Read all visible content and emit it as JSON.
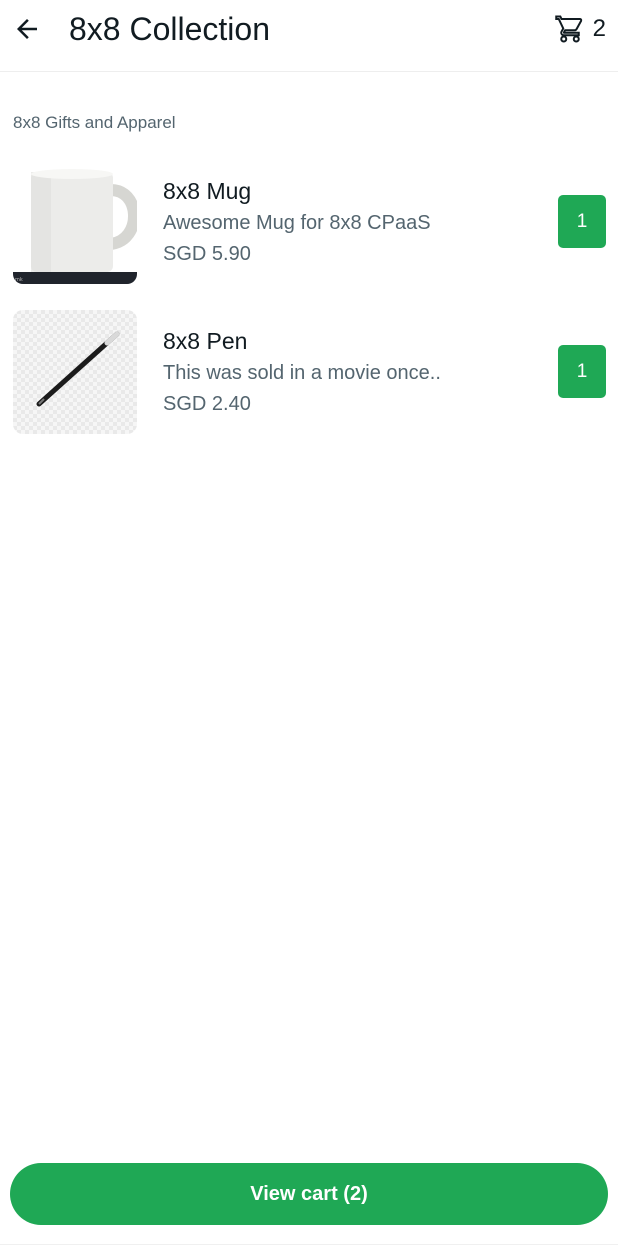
{
  "header": {
    "title": "8x8 Collection",
    "back_icon": "arrow-left-icon",
    "cart_icon": "cart-icon",
    "cart_count": "2"
  },
  "section": {
    "label": "8x8 Gifts and Apparel"
  },
  "products": [
    {
      "name": "8x8 Mug",
      "description": "Awesome Mug for 8x8 CPaaS",
      "price": "SGD 5.90",
      "quantity": "1",
      "image": "mug-image"
    },
    {
      "name": "8x8 Pen",
      "description": "This was sold in a movie once..",
      "price": "SGD 2.40",
      "quantity": "1",
      "image": "pen-image"
    }
  ],
  "footer": {
    "view_cart_label": "View cart (2)"
  },
  "colors": {
    "accent": "#1fa855",
    "text_primary": "#111b21",
    "text_secondary": "#54656f"
  }
}
